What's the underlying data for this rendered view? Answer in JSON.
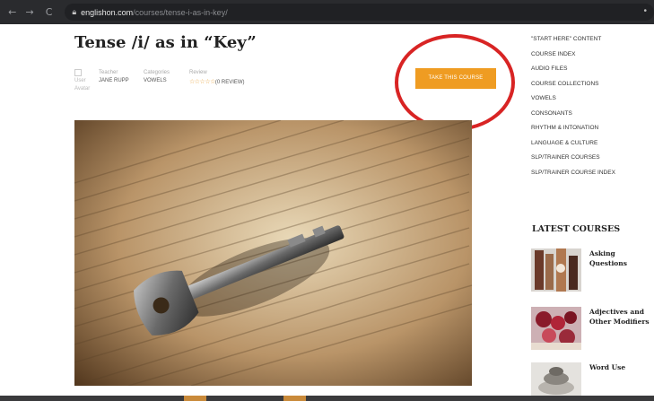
{
  "browser": {
    "url_host": "englishon.com",
    "url_path": "/courses/tense-i-as-in-key/"
  },
  "course": {
    "title": "Tense /i/ as in “Key”",
    "avatar_alt": "User Avatar",
    "teacher_label": "Teacher",
    "teacher_name": "JANE RUPP",
    "categories_label": "Categories",
    "category": "VOWELS",
    "review_label": "Review",
    "stars": "☆☆☆☆☆",
    "review_count": "(0 REVIEW)",
    "take_course_label": "TAKE THIS COURSE"
  },
  "sidebar": {
    "menu": [
      "\"START HERE\" CONTENT",
      "COURSE INDEX",
      "AUDIO FILES",
      "COURSE COLLECTIONS",
      "VOWELS",
      "CONSONANTS",
      "RHYTHM & INTONATION",
      "LANGUAGE & CULTURE",
      "SLP/TRAINER COURSES",
      "SLP/TRAINER COURSE INDEX"
    ],
    "latest_title": "LATEST COURSES",
    "latest": [
      {
        "name": "Asking Questions"
      },
      {
        "name": "Adjectives and Other Modifiers"
      },
      {
        "name": "Word Use"
      }
    ]
  },
  "colors": {
    "accent": "#ef9c22",
    "annotation": "#d82424"
  }
}
